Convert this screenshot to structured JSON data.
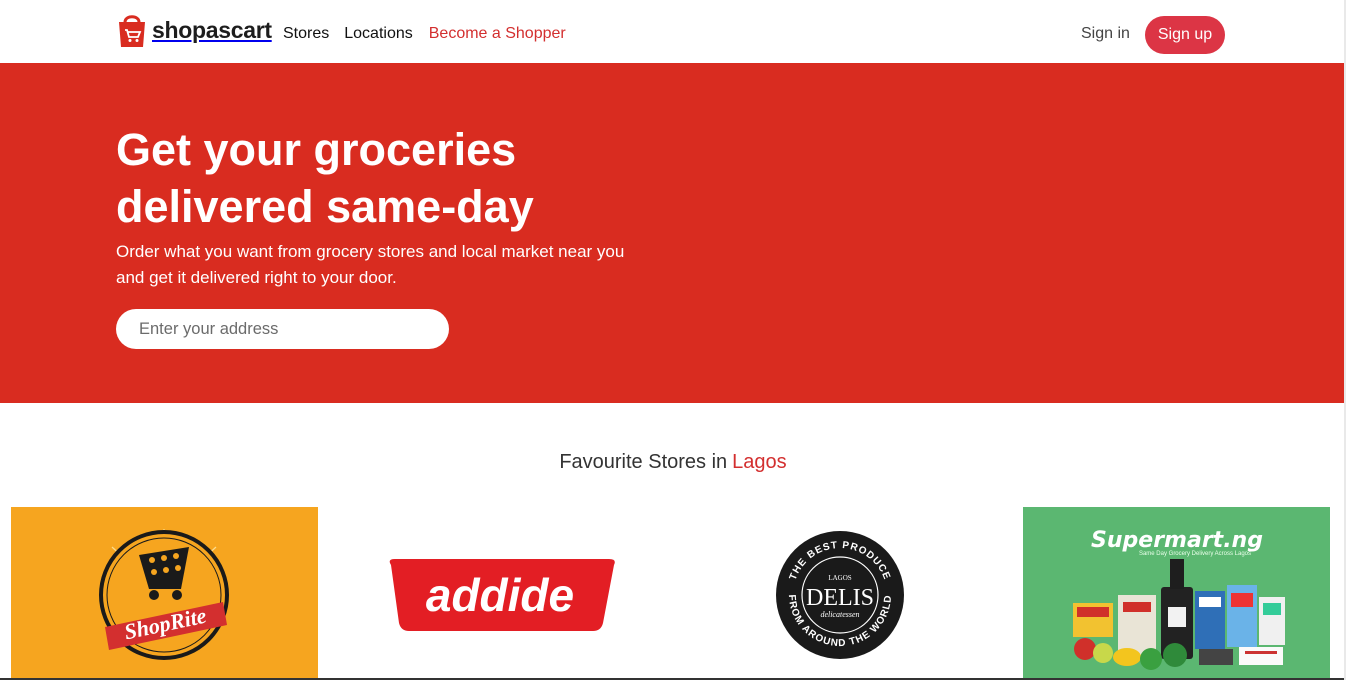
{
  "brand": {
    "name": "shopascart",
    "color": "#d92c20"
  },
  "nav": {
    "items": [
      "Stores",
      "Locations"
    ],
    "become_shopper": "Become a Shopper"
  },
  "auth": {
    "sign_in": "Sign in",
    "sign_up": "Sign up"
  },
  "hero": {
    "title_line1": "Get your groceries",
    "title_line2": "delivered same-day",
    "subtitle_line1": "Order what you want from grocery stores and local market near you",
    "subtitle_line2": "and get it delivered right to your door.",
    "address_placeholder": "Enter your address"
  },
  "favourites": {
    "heading": "Favourite Stores in",
    "city": "Lagos"
  },
  "stores": [
    {
      "name": "ShopRite",
      "logo_text": "ShopRite",
      "bg": "#f6a51f"
    },
    {
      "name": "addide",
      "logo_text": "addide",
      "bg": "#ffffff"
    },
    {
      "name": "Lagos Delis",
      "ring_top": "THE BEST PRODUCE",
      "ring_bottom": "FROM AROUND THE WORLD",
      "small": "LAGOS",
      "main": "DELIS",
      "script": "delicatessen",
      "bg": "#ffffff"
    },
    {
      "name": "Supermart.ng",
      "logo_text": "Supermart.ng",
      "tagline": "Same Day Grocery Delivery Across Lagos",
      "bg": "#5bb771"
    }
  ]
}
